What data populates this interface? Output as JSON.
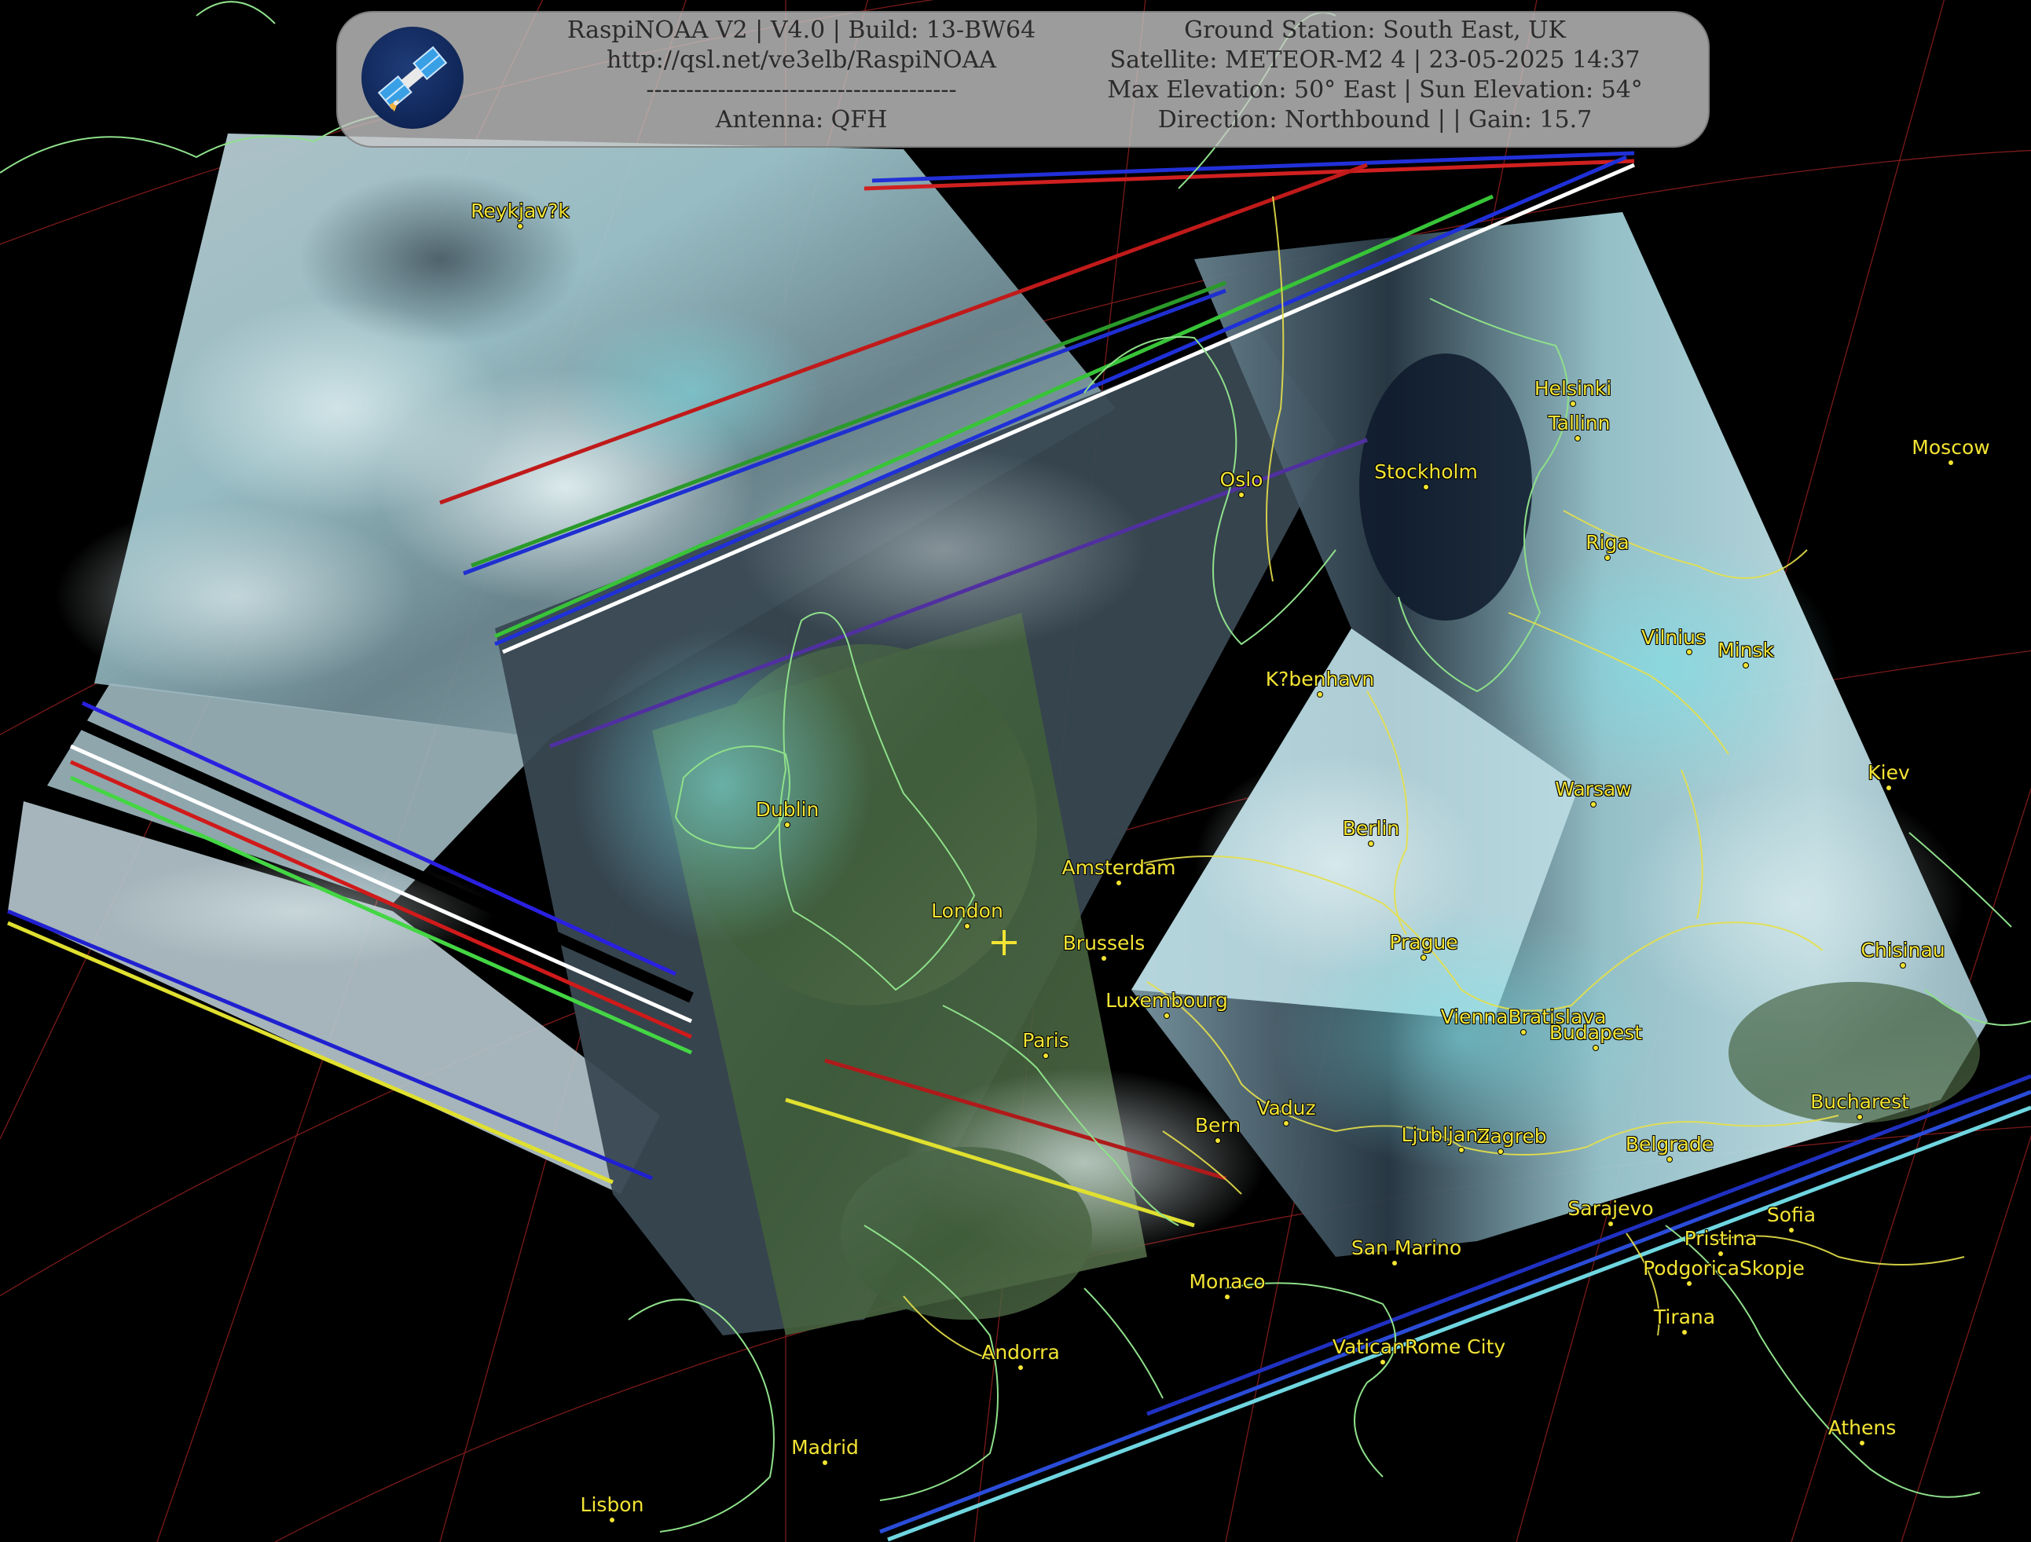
{
  "header": {
    "left": {
      "line1": "RaspiNOAA V2 | V4.0 | Build: 13-BW64",
      "line2": "http://qsl.net/ve3elb/RaspiNOAA",
      "line3": "---------------------------------------",
      "line4": "Antenna: QFH"
    },
    "right": {
      "line1": "Ground Station: South East, UK",
      "line2": "Satellite: METEOR-M2 4 | 23-05-2025 14:37",
      "line3": "Max Elevation: 50° East | Sun Elevation: 54°",
      "line4": "Direction: Northbound | | Gain: 15.7"
    }
  },
  "logo_icon": "satellite-icon",
  "colors": {
    "background": "#000000",
    "city_label": "#f3e433",
    "coastline": "#8ee08a",
    "borders": "#e6e04a",
    "graticule": "#9a2020",
    "cloud": "#cfe8ec",
    "cyan": "#6fd6e0",
    "land": "#3b5a32"
  },
  "cities": [
    {
      "name": "Reykjav?k"
    },
    {
      "name": "Helsinki"
    },
    {
      "name": "Tallinn"
    },
    {
      "name": "Moscow"
    },
    {
      "name": "Oslo"
    },
    {
      "name": "Stockholm"
    },
    {
      "name": "Riga"
    },
    {
      "name": "Vilnius"
    },
    {
      "name": "Minsk"
    },
    {
      "name": "K?benhavn"
    },
    {
      "name": "Dublin"
    },
    {
      "name": "Warsaw"
    },
    {
      "name": "Kiev"
    },
    {
      "name": "Berlin"
    },
    {
      "name": "Amsterdam"
    },
    {
      "name": "London"
    },
    {
      "name": "Brussels"
    },
    {
      "name": "Prague"
    },
    {
      "name": "Chisinau"
    },
    {
      "name": "Luxembourg"
    },
    {
      "name": "ViennaBratislava"
    },
    {
      "name": "Budapest"
    },
    {
      "name": "Paris"
    },
    {
      "name": "Bucharest"
    },
    {
      "name": "Vaduz"
    },
    {
      "name": "Bern"
    },
    {
      "name": "Ljubljana"
    },
    {
      "name": "Zagreb"
    },
    {
      "name": "Belgrade"
    },
    {
      "name": "Sarajevo"
    },
    {
      "name": "Sofia"
    },
    {
      "name": "Pristina"
    },
    {
      "name": "San Marino"
    },
    {
      "name": "Monaco"
    },
    {
      "name": "PodgoricaSkopje"
    },
    {
      "name": "Tirana"
    },
    {
      "name": "VaticanRome City"
    },
    {
      "name": "Andorra"
    },
    {
      "name": "Madrid"
    },
    {
      "name": "Athens"
    },
    {
      "name": "Lisbon"
    }
  ],
  "city_labels": {
    "reykjavik": "Reykjav?k",
    "helsinki": "Helsinki",
    "tallinn": "Tallinn",
    "moscow": "Moscow",
    "oslo": "Oslo",
    "stockholm": "Stockholm",
    "riga": "Riga",
    "vilnius": "Vilnius",
    "minsk": "Minsk",
    "kobenhavn": "K?benhavn",
    "dublin": "Dublin",
    "warsaw": "Warsaw",
    "kiev": "Kiev",
    "berlin": "Berlin",
    "amsterdam": "Amsterdam",
    "london": "London",
    "brussels": "Brussels",
    "prague": "Prague",
    "chisinau": "Chisinau",
    "luxembourg": "Luxembourg",
    "vienna": "ViennaBratislava",
    "budapest": "Budapest",
    "paris": "Paris",
    "bucharest": "Bucharest",
    "vaduz": "Vaduz",
    "bern": "Bern",
    "ljubljana": "Ljubljana",
    "zagreb": "Zagreb",
    "belgrade": "Belgrade",
    "sarajevo": "Sarajevo",
    "sofia": "Sofia",
    "pristina": "Pristina",
    "sanmarino": "San Marino",
    "monaco": "Monaco",
    "podgorica": "PodgoricaSkopje",
    "tirana": "Tirana",
    "vatican": "VaticanRome City",
    "andorra": "Andorra",
    "madrid": "Madrid",
    "athens": "Athens",
    "lisbon": "Lisbon"
  },
  "station_marker_icon": "ground-station-cross-icon"
}
